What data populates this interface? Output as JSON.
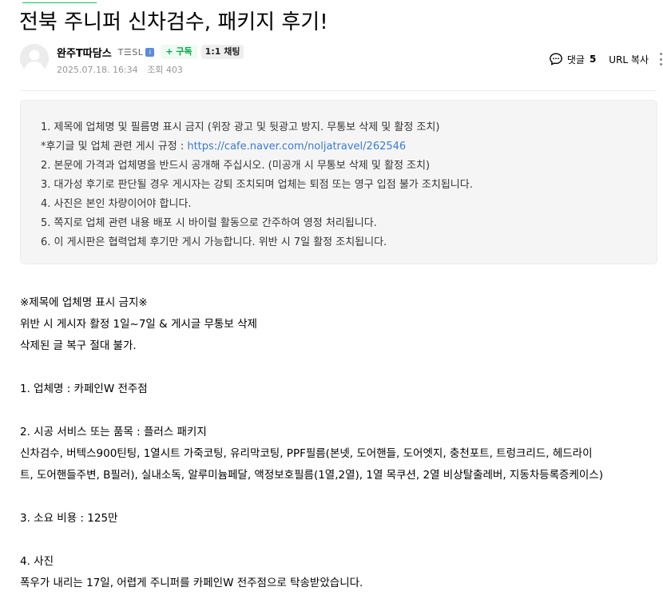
{
  "post": {
    "title": "전북 주니퍼 신차검수, 패키지 후기!"
  },
  "author": {
    "nickname": "완주T따담스",
    "grade": "T☰SL",
    "subscribe_label": "+ 구독",
    "chat_label": "1:1 채팅",
    "date": "2025.07.18. 16:34",
    "views": "조회 403"
  },
  "tools": {
    "comment_label": "댓글",
    "comment_count": "5",
    "url_copy_label": "URL 복사"
  },
  "notice": {
    "line1": "1. 제목에 업체명 및 필름명 표시 금지 (위장 광고 및 뒷광고 방지. 무통보 삭제 및 활정 조치)",
    "line2_prefix": "*후기글 및 업체 관련 게시 규정 : ",
    "line2_link": "https://cafe.naver.com/noljatravel/262546",
    "line3": "2. 본문에 가격과 업체명을 반드시 공개해 주십시오. (미공개 시 무통보 삭제 및 활정 조치)",
    "line4": "3. 대가성 후기로 판단될 경우 게시자는 강퇴 조치되며 업체는 퇴점 또는 영구 입점 불가 조치됩니다.",
    "line5": "4. 사진은 본인 차량이어야 합니다.",
    "line6": "5. 쪽지로 업체 관련 내용 배포 시 바이럴 활동으로 간주하여 영정 처리됩니다.",
    "line7": "6. 이 게시판은 협력업체 후기만 게시 가능합니다. 위반 시 7일 활정 조치됩니다."
  },
  "content": {
    "warn1": "※제목에 업체명 표시 금지※",
    "warn2": "위반 시 게시자 활정 1일~7일 & 게시글 무통보 삭제",
    "warn3": "삭제된 글 복구 절대 불가.",
    "q1": "1. 업체명 :  카페인W 전주점",
    "q2": "2. 시공 서비스 또는 품목 :  플러스 패키지",
    "q2_detail1": "신차검수, 버텍스900틴팅, 1열시트 가죽코팅, 유리막코팅, PPF필름(본넷, 도어핸들, 도어엣지, 충천포트, 트렁크리드, 헤드라이",
    "q2_detail2": "트, 도어핸들주변, B필러), 실내소독, 알루미늄페달, 액정보호필름(1열,2열), 1열 목쿠션, 2열 비상탈출레버, 지동차등록증케이스)",
    "q3": "3. 소요 비용 :  125만",
    "q4": "4. 사진",
    "q4_text": "폭우가 내리는 17일, 어렵게 주니퍼를 카페인W 전주점으로 탁송받았습니다."
  },
  "colors": {
    "accent_green": "#03c75a",
    "link_blue": "#3b7ccd",
    "meta_gray": "#979797",
    "notice_bg": "#f5f5f5"
  },
  "icons": {
    "avatar": "default-profile-icon",
    "grade": "grade-badge-icon",
    "comment": "speech-bubble-icon",
    "more": "vertical-dots-icon"
  }
}
